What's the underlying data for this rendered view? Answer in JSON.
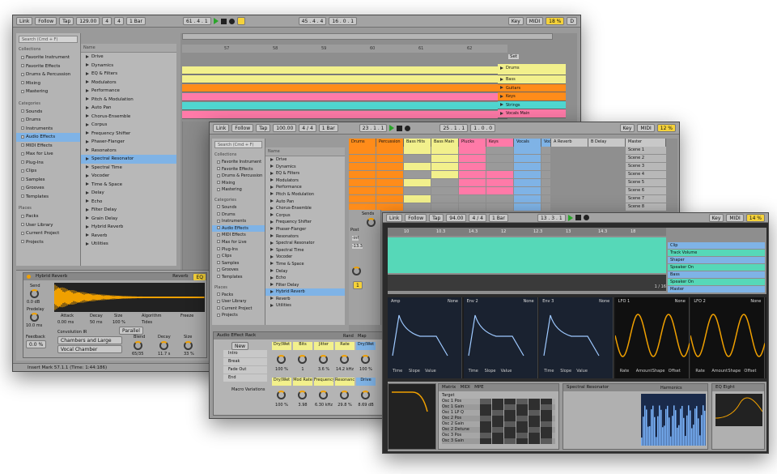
{
  "colors": {
    "orange": "#ff8c1a",
    "yellow": "#f2f08c",
    "blue": "#7fb3e6",
    "cyan": "#4fd6d0",
    "pink": "#ff7aa8",
    "green": "#8fd16a",
    "teal": "#56d8b8",
    "amber": "#f0a000"
  },
  "icons": [
    "play-icon",
    "stop-icon",
    "record-icon",
    "search-icon",
    "triangle-icon",
    "folder-icon"
  ],
  "w1": {
    "toolbar": {
      "link": "Link",
      "follow": "Follow",
      "tap": "Tap",
      "tempo": "129.00",
      "meter_num": "4",
      "meter_den": "4",
      "quant": "1 Bar",
      "pos": "61 .  4 .  1",
      "pos2": "45 .  4 .  4",
      "pos3": "16 .  0 .  1",
      "key": "Key",
      "midi": "MIDI",
      "cpu": "18 %",
      "pct": "D"
    },
    "browser": {
      "search": "Search (Cmd + F)",
      "collections_title": "Collections",
      "collections": [
        "Favorite Instrument",
        "Favorite Effects",
        "Drums & Percussion",
        "Mixing",
        "Mastering"
      ],
      "categories_title": "Categories",
      "categories": [
        "Sounds",
        "Drums",
        "Instruments",
        "Audio Effects",
        "MIDI Effects",
        "Max for Live",
        "Plug-Ins",
        "Clips",
        "Samples",
        "Grooves",
        "Templates"
      ],
      "places_title": "Places",
      "places": [
        "Packs",
        "User Library",
        "Current Project",
        "Projects"
      ],
      "name_header": "Name",
      "items": [
        "Drive",
        "Dynamics",
        "EQ & Filters",
        "Modulators",
        "Performance",
        "Pitch & Modulation",
        "Auto Pan",
        "Chorus-Ensemble",
        "Corpus",
        "Frequency Shifter",
        "Phaser-Flanger",
        "Resonators",
        "Spectral Resonator",
        "Spectral Time",
        "Vocoder",
        "Time & Space",
        "Delay",
        "Echo",
        "Filter Delay",
        "Grain Delay",
        "Hybrid Reverb",
        "Reverb",
        "Utilities"
      ]
    },
    "ruler": [
      "57",
      "58",
      "59",
      "60",
      "61",
      "62"
    ],
    "set_label": "Set",
    "tracks": [
      "Drums",
      "Bass",
      "Guitars",
      "Keys",
      "Strings",
      "Vocals Main"
    ],
    "device": {
      "title": "Hybrid Reverb",
      "reverb_tab": "Reverb",
      "eq_tab": "EQ",
      "send": "Send",
      "send_val": "0.0 dB",
      "predelay": "Predelay",
      "predelay_val": "10.0 ms",
      "feedback": "Feedback",
      "feedback_val": "0.0 %",
      "attack": "Attack",
      "attack_val": "0.00 ms",
      "decay": "Decay",
      "decay_val": "50 ms",
      "size": "Size",
      "size_val": "100 %",
      "algorithm": "Algorithm",
      "algorithm_val": "Tides",
      "freeze": "Freeze",
      "routing": "Parallel",
      "convolution": "Convolution IR",
      "ir1": "Chambers and Large Rooms",
      "ir2": "Vocal Chamber",
      "blend": "Blend",
      "blend_val": "65/35",
      "decay2": "Decay",
      "decay2_val": "11.7 s",
      "size2": "Size",
      "size2_val": "33 %"
    },
    "status": "Insert Mark 57.1.1 (Time: 1:44:186)"
  },
  "w2": {
    "toolbar": {
      "link": "Link",
      "follow": "Follow",
      "tap": "Tap",
      "tempo": "100.00",
      "meter": "4 / 4",
      "quant": "1 Bar",
      "pos": "23 .  1 .  1",
      "pos2": "25 .  1 .  1",
      "pos3": "1 .  0 .  0",
      "key": "Key",
      "midi": "MIDI",
      "cpu": "12 %"
    },
    "browser": {
      "search": "Search (Cmd + F)",
      "collections_title": "Collections",
      "collections": [
        "Favorite Instrument",
        "Favorite Effects",
        "Drums & Percussion",
        "Mixing",
        "Mastering"
      ],
      "categories_title": "Categories",
      "categories": [
        "Sounds",
        "Drums",
        "Instruments",
        "Audio Effects",
        "MIDI Effects",
        "Max for Live",
        "Plug-Ins",
        "Clips",
        "Samples",
        "Grooves",
        "Templates"
      ],
      "places_title": "Places",
      "places": [
        "Packs",
        "User Library",
        "Current Project",
        "Projects"
      ],
      "name_header": "Name",
      "items": [
        "Drive",
        "Dynamics",
        "EQ & Filters",
        "Modulators",
        "Performance",
        "Pitch & Modulation",
        "Auto Pan",
        "Chorus-Ensemble",
        "Corpus",
        "Frequency Shifter",
        "Phaser-Flanger",
        "Resonators",
        "Spectral Resonator",
        "Spectral Time",
        "Vocoder",
        "Time & Space",
        "Delay",
        "Echo",
        "Filter Delay",
        "Hybrid Reverb",
        "Reverb",
        "Utilities"
      ]
    },
    "session_tracks": [
      "Drums",
      "Percussion",
      "Bass Hits",
      "Bass Main",
      "Plucks",
      "Keys",
      "Vocals",
      "Voca",
      "A Reverb",
      "B Delay",
      "Master"
    ],
    "scenes": [
      "Scene 1",
      "Scene 2",
      "Scene 3",
      "Scene 4",
      "Scene 5",
      "Scene 6",
      "Scene 7",
      "Scene 8"
    ],
    "rack": {
      "title": "Audio Effect Rack",
      "new": "New",
      "chains": [
        "Intro",
        "Break",
        "Fade Out",
        "End"
      ],
      "macro_var": "Macro Variations",
      "rand": "Rand",
      "map": "Map",
      "macros": [
        {
          "name": "Dry/Wet",
          "val": "100 %"
        },
        {
          "name": "Bits",
          "val": "1"
        },
        {
          "name": "Jitter",
          "val": "3.6 %"
        },
        {
          "name": "Rate",
          "val": "14.2 kHz"
        },
        {
          "name": "Dry/Wet",
          "val": "100 %"
        },
        {
          "name": "Dry/Wet",
          "val": "100 %"
        },
        {
          "name": "Mod Rate",
          "val": "3.98"
        },
        {
          "name": "Frequency",
          "val": "6.30 kHz"
        },
        {
          "name": "Resonance",
          "val": "29.8 %"
        },
        {
          "name": "Drive",
          "val": "8.69 dB"
        }
      ]
    },
    "send_label": "Sends",
    "post_label": "Post",
    "val_inf": "-inf",
    "val_133": "-13.3"
  },
  "w3": {
    "toolbar": {
      "link": "Link",
      "follow": "Follow",
      "tap": "Tap",
      "tempo": "94.00",
      "meter": "4 / 4",
      "quant": "1 Bar",
      "pos": "13 .  3 .  1",
      "key": "Key",
      "midi": "MIDI",
      "cpu": "14 %"
    },
    "ruler": [
      "10",
      "10.3",
      "14.3",
      "12",
      "12.3",
      "13",
      "14.3",
      "18"
    ],
    "lanes": [
      "Clip",
      "Track Volume",
      "Shaper",
      "Speaker On",
      "Bass",
      "Speaker On",
      "Master"
    ],
    "time_readout": "1 / 16",
    "mod_panels": [
      {
        "title": "Amp",
        "mode": "None",
        "labels": [
          "Time",
          "Slope",
          "Value"
        ]
      },
      {
        "title": "Env 2",
        "mode": "None",
        "labels": [
          "Time",
          "Slope",
          "Value"
        ]
      },
      {
        "title": "Env 3",
        "mode": "None",
        "labels": [
          "Time",
          "Slope",
          "Value"
        ]
      },
      {
        "title": "LFO 1",
        "mode": "None",
        "labels": [
          "Rate",
          "Amount",
          "Shape",
          "Offset"
        ]
      },
      {
        "title": "LFO 2",
        "mode": "None",
        "labels": [
          "Rate",
          "Amount",
          "Shape",
          "Offset"
        ]
      }
    ],
    "devices": {
      "wave_title": "Spectral Resonator",
      "harmonics": "Harmonics",
      "eq_title": "EQ Eight",
      "matrix": "Matrix",
      "midi": "MIDI",
      "mpe": "MPE",
      "mod_rows": [
        "Osc 1 Pos",
        "Osc 1 Gain",
        "Osc 1 LP Q",
        "Osc 2 Pos",
        "Osc 2 Gain",
        "Osc 2 Detune",
        "Osc 3 Pos",
        "Osc 3 Gain"
      ],
      "target": "Target"
    }
  }
}
